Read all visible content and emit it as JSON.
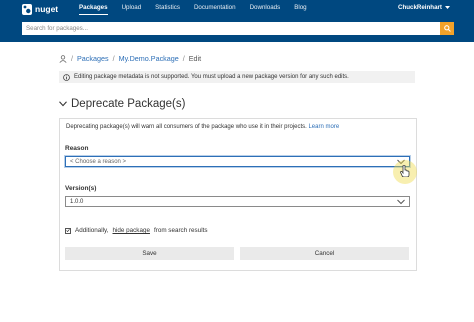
{
  "header": {
    "brand": "nuget",
    "nav": [
      "Packages",
      "Upload",
      "Statistics",
      "Documentation",
      "Downloads",
      "Blog"
    ],
    "active_nav": "Packages",
    "user": "ChuckReinhart",
    "search_placeholder": "Search for packages...",
    "accent": "#f2a229",
    "bar_color": "#004880"
  },
  "breadcrumb": {
    "items": [
      "Packages",
      "My.Demo.Package",
      "Edit"
    ],
    "separator": "/"
  },
  "warning": {
    "text": "Editing package metadata is not supported. You must upload a new package version for any such edits."
  },
  "section": {
    "title": "Deprecate Package(s)"
  },
  "form": {
    "intro": "Deprecating package(s) will warn all consumers of the package who use it in their projects.",
    "learn_more": "Learn more",
    "reason_label": "Reason",
    "reason_value": "< Choose a reason >",
    "versions_label": "Version(s)",
    "versions_value": "1.0.0",
    "checkbox_checked": true,
    "checkbox_prefix": "Additionally,",
    "checkbox_link": "hide package",
    "checkbox_suffix": "from search results",
    "save": "Save",
    "cancel": "Cancel"
  }
}
